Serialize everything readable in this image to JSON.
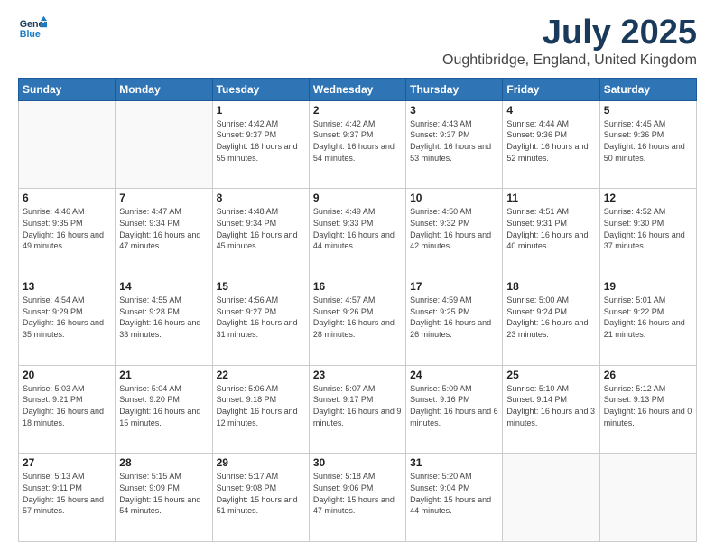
{
  "logo": {
    "line1": "General",
    "line2": "Blue"
  },
  "title": "July 2025",
  "location": "Oughtibridge, England, United Kingdom",
  "days_of_week": [
    "Sunday",
    "Monday",
    "Tuesday",
    "Wednesday",
    "Thursday",
    "Friday",
    "Saturday"
  ],
  "weeks": [
    [
      {
        "day": "",
        "info": ""
      },
      {
        "day": "",
        "info": ""
      },
      {
        "day": "1",
        "info": "Sunrise: 4:42 AM\nSunset: 9:37 PM\nDaylight: 16 hours and 55 minutes."
      },
      {
        "day": "2",
        "info": "Sunrise: 4:42 AM\nSunset: 9:37 PM\nDaylight: 16 hours and 54 minutes."
      },
      {
        "day": "3",
        "info": "Sunrise: 4:43 AM\nSunset: 9:37 PM\nDaylight: 16 hours and 53 minutes."
      },
      {
        "day": "4",
        "info": "Sunrise: 4:44 AM\nSunset: 9:36 PM\nDaylight: 16 hours and 52 minutes."
      },
      {
        "day": "5",
        "info": "Sunrise: 4:45 AM\nSunset: 9:36 PM\nDaylight: 16 hours and 50 minutes."
      }
    ],
    [
      {
        "day": "6",
        "info": "Sunrise: 4:46 AM\nSunset: 9:35 PM\nDaylight: 16 hours and 49 minutes."
      },
      {
        "day": "7",
        "info": "Sunrise: 4:47 AM\nSunset: 9:34 PM\nDaylight: 16 hours and 47 minutes."
      },
      {
        "day": "8",
        "info": "Sunrise: 4:48 AM\nSunset: 9:34 PM\nDaylight: 16 hours and 45 minutes."
      },
      {
        "day": "9",
        "info": "Sunrise: 4:49 AM\nSunset: 9:33 PM\nDaylight: 16 hours and 44 minutes."
      },
      {
        "day": "10",
        "info": "Sunrise: 4:50 AM\nSunset: 9:32 PM\nDaylight: 16 hours and 42 minutes."
      },
      {
        "day": "11",
        "info": "Sunrise: 4:51 AM\nSunset: 9:31 PM\nDaylight: 16 hours and 40 minutes."
      },
      {
        "day": "12",
        "info": "Sunrise: 4:52 AM\nSunset: 9:30 PM\nDaylight: 16 hours and 37 minutes."
      }
    ],
    [
      {
        "day": "13",
        "info": "Sunrise: 4:54 AM\nSunset: 9:29 PM\nDaylight: 16 hours and 35 minutes."
      },
      {
        "day": "14",
        "info": "Sunrise: 4:55 AM\nSunset: 9:28 PM\nDaylight: 16 hours and 33 minutes."
      },
      {
        "day": "15",
        "info": "Sunrise: 4:56 AM\nSunset: 9:27 PM\nDaylight: 16 hours and 31 minutes."
      },
      {
        "day": "16",
        "info": "Sunrise: 4:57 AM\nSunset: 9:26 PM\nDaylight: 16 hours and 28 minutes."
      },
      {
        "day": "17",
        "info": "Sunrise: 4:59 AM\nSunset: 9:25 PM\nDaylight: 16 hours and 26 minutes."
      },
      {
        "day": "18",
        "info": "Sunrise: 5:00 AM\nSunset: 9:24 PM\nDaylight: 16 hours and 23 minutes."
      },
      {
        "day": "19",
        "info": "Sunrise: 5:01 AM\nSunset: 9:22 PM\nDaylight: 16 hours and 21 minutes."
      }
    ],
    [
      {
        "day": "20",
        "info": "Sunrise: 5:03 AM\nSunset: 9:21 PM\nDaylight: 16 hours and 18 minutes."
      },
      {
        "day": "21",
        "info": "Sunrise: 5:04 AM\nSunset: 9:20 PM\nDaylight: 16 hours and 15 minutes."
      },
      {
        "day": "22",
        "info": "Sunrise: 5:06 AM\nSunset: 9:18 PM\nDaylight: 16 hours and 12 minutes."
      },
      {
        "day": "23",
        "info": "Sunrise: 5:07 AM\nSunset: 9:17 PM\nDaylight: 16 hours and 9 minutes."
      },
      {
        "day": "24",
        "info": "Sunrise: 5:09 AM\nSunset: 9:16 PM\nDaylight: 16 hours and 6 minutes."
      },
      {
        "day": "25",
        "info": "Sunrise: 5:10 AM\nSunset: 9:14 PM\nDaylight: 16 hours and 3 minutes."
      },
      {
        "day": "26",
        "info": "Sunrise: 5:12 AM\nSunset: 9:13 PM\nDaylight: 16 hours and 0 minutes."
      }
    ],
    [
      {
        "day": "27",
        "info": "Sunrise: 5:13 AM\nSunset: 9:11 PM\nDaylight: 15 hours and 57 minutes."
      },
      {
        "day": "28",
        "info": "Sunrise: 5:15 AM\nSunset: 9:09 PM\nDaylight: 15 hours and 54 minutes."
      },
      {
        "day": "29",
        "info": "Sunrise: 5:17 AM\nSunset: 9:08 PM\nDaylight: 15 hours and 51 minutes."
      },
      {
        "day": "30",
        "info": "Sunrise: 5:18 AM\nSunset: 9:06 PM\nDaylight: 15 hours and 47 minutes."
      },
      {
        "day": "31",
        "info": "Sunrise: 5:20 AM\nSunset: 9:04 PM\nDaylight: 15 hours and 44 minutes."
      },
      {
        "day": "",
        "info": ""
      },
      {
        "day": "",
        "info": ""
      }
    ]
  ]
}
